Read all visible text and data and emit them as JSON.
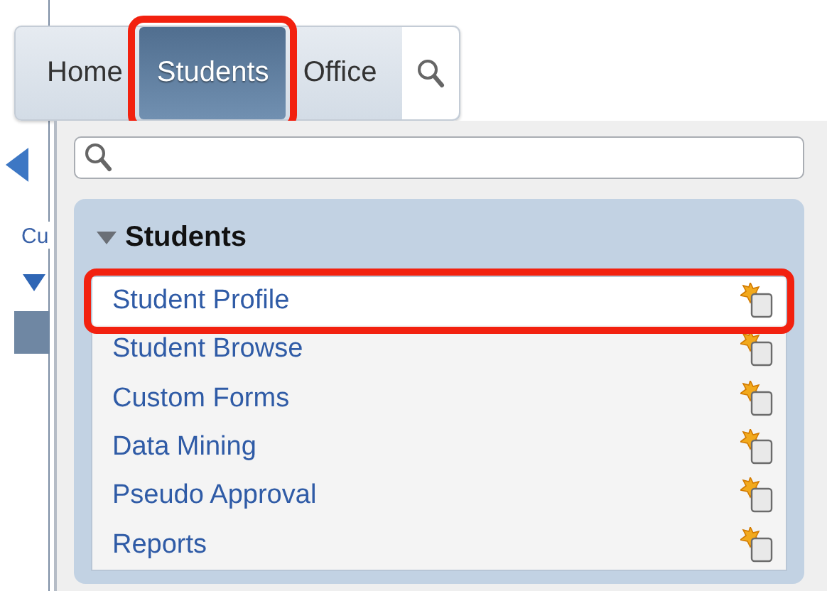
{
  "background_page": {
    "column_label": "Cu"
  },
  "tabs": [
    {
      "label": "Home",
      "selected": false,
      "highlighted": false
    },
    {
      "label": "Students",
      "selected": true,
      "highlighted": true
    },
    {
      "label": "Office",
      "selected": false,
      "highlighted": false
    }
  ],
  "menu": {
    "group": {
      "title": "Students",
      "expanded": true,
      "items": [
        {
          "label": "Student Profile",
          "highlighted": true
        },
        {
          "label": "Student Browse",
          "highlighted": false
        },
        {
          "label": "Custom Forms",
          "highlighted": false
        },
        {
          "label": "Data Mining",
          "highlighted": false
        },
        {
          "label": "Pseudo Approval",
          "highlighted": false
        },
        {
          "label": "Reports",
          "highlighted": false
        }
      ]
    }
  }
}
